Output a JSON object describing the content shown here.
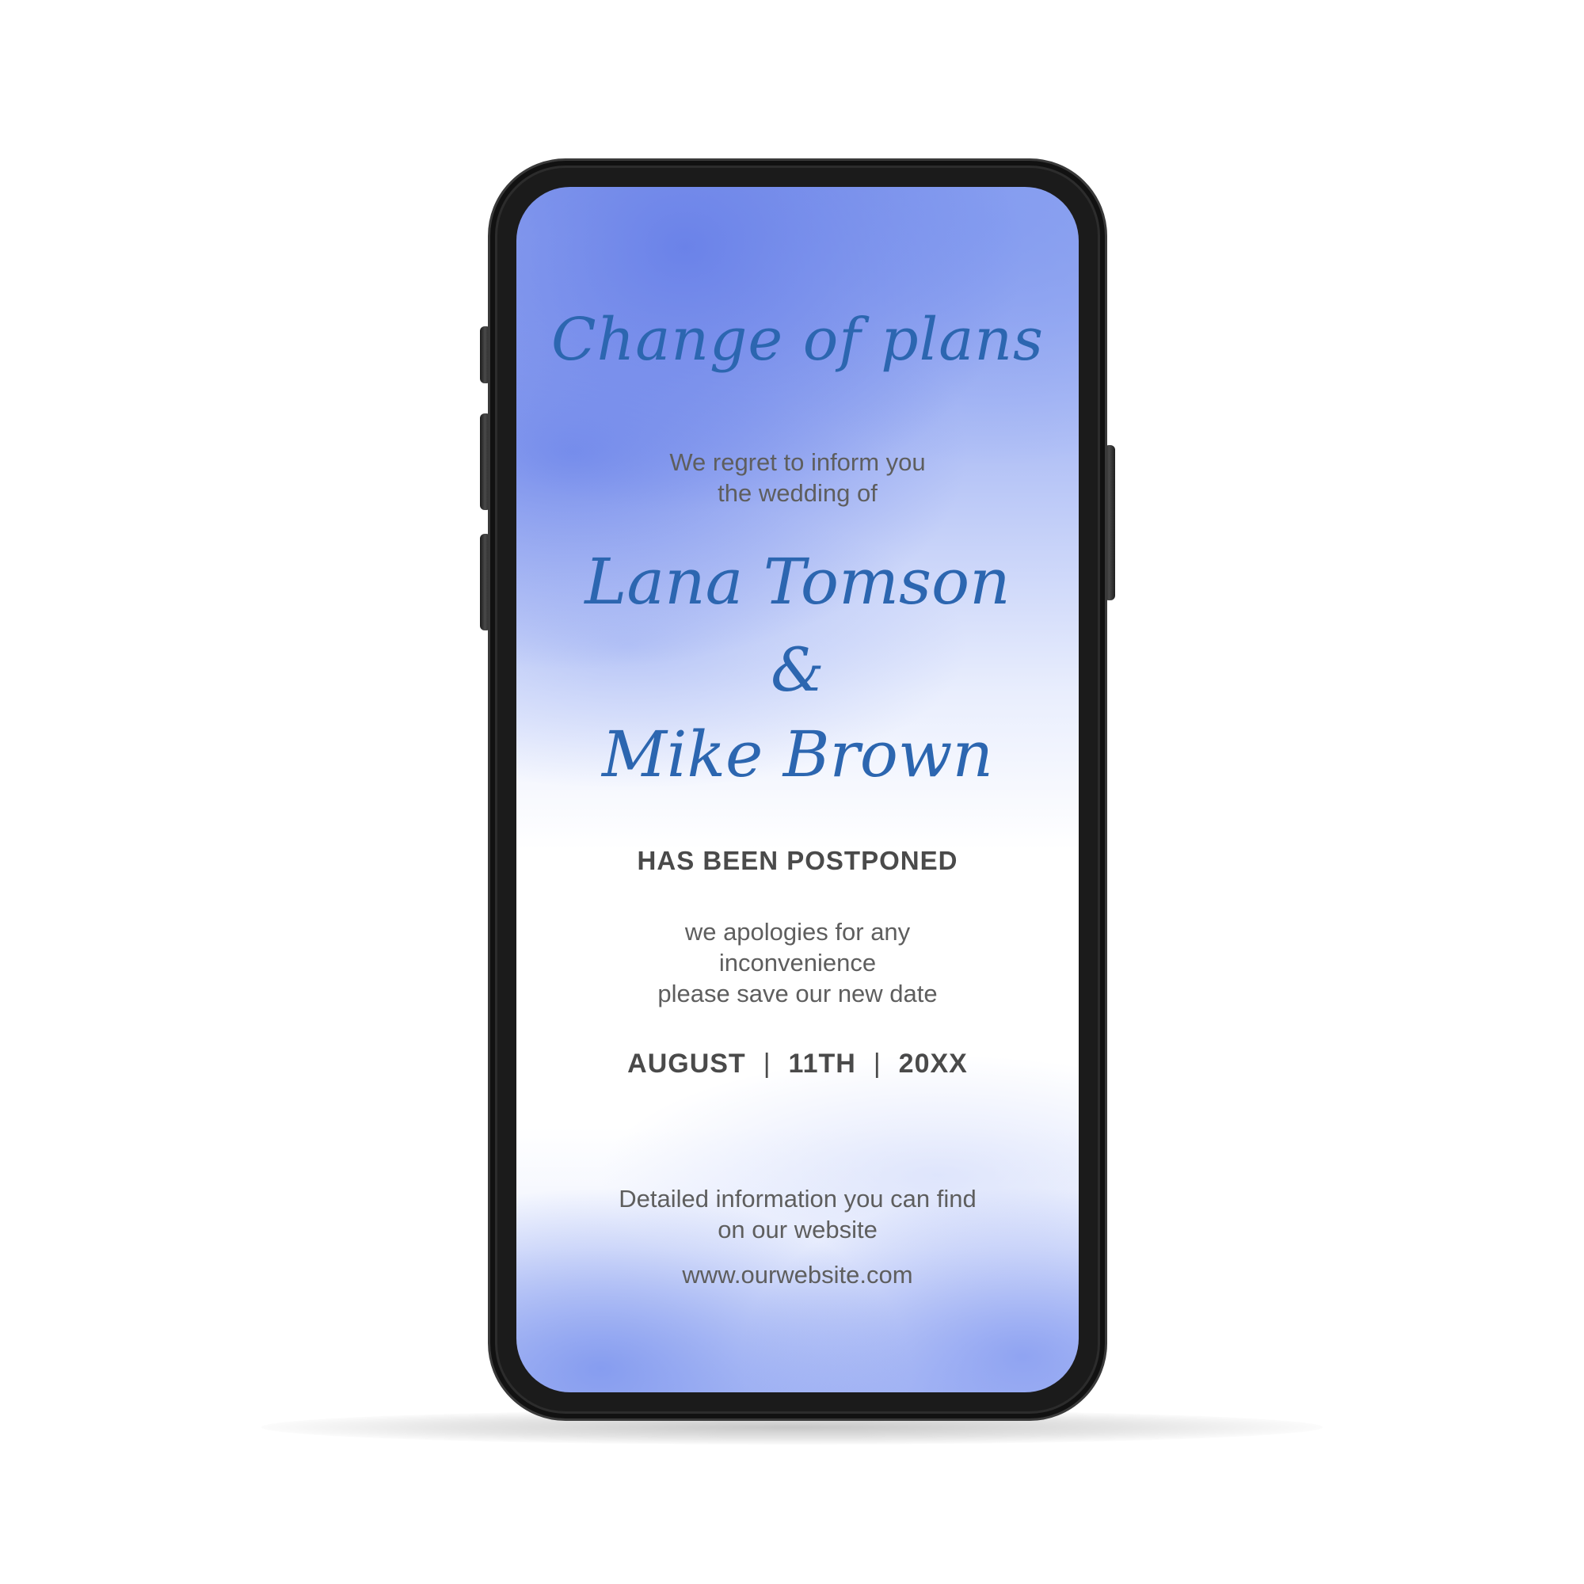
{
  "invitation": {
    "title": "Change of plans",
    "regret_line_1": "We regret to inform you",
    "regret_line_2": "the wedding of",
    "name_1": "Lana Tomson",
    "ampersand": "&",
    "name_2": "Mike Brown",
    "status": "HAS BEEN POSTPONED",
    "apology_line_1": "we apologies for any",
    "apology_line_2": "inconvenience",
    "apology_line_3": "please save our new date",
    "date": {
      "month": "AUGUST",
      "separator": "|",
      "day": "11TH",
      "year": "20XX"
    },
    "details_line_1": "Detailed information you can find",
    "details_line_2": "on our website",
    "website": "www.ourwebsite.com"
  },
  "colors": {
    "accent_script": "#2c66b0",
    "watercolor_blue": "#8ea3ef",
    "body_text": "#5e5e5e",
    "heading_text": "#4a4a4a",
    "phone_frame": "#1b1b1b"
  }
}
